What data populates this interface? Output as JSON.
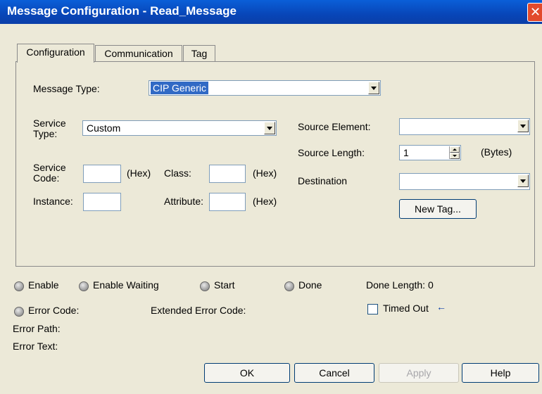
{
  "window": {
    "title": "Message Configuration - Read_Message",
    "close_glyph": "✕"
  },
  "tabs": [
    {
      "label": "Configuration",
      "active": true
    },
    {
      "label": "Communication",
      "active": false
    },
    {
      "label": "Tag",
      "active": false
    }
  ],
  "config": {
    "message_type_label": "Message Type:",
    "message_type_value": "CIP Generic",
    "service_type_label_1": "Service",
    "service_type_label_2": "Type:",
    "service_type_value": "Custom",
    "service_code_label_1": "Service",
    "service_code_label_2": "Code:",
    "service_code_value": "",
    "hex_label": "(Hex)",
    "class_label": "Class:",
    "class_value": "",
    "instance_label": "Instance:",
    "instance_value": "",
    "attribute_label": "Attribute:",
    "attribute_value": "",
    "source_element_label": "Source Element:",
    "source_element_value": "",
    "source_length_label": "Source Length:",
    "source_length_value": "1",
    "bytes_label": "(Bytes)",
    "destination_label": "Destination",
    "destination_value": "",
    "new_tag_label": "New Tag..."
  },
  "status": {
    "enable": "Enable",
    "enable_waiting": "Enable Waiting",
    "start": "Start",
    "done": "Done",
    "done_length": "Done Length: 0",
    "error_code": "Error Code:",
    "extended_error_code": "Extended Error Code:",
    "timed_out": "Timed Out",
    "timed_out_checked": false,
    "error_path": "Error Path:",
    "error_text": "Error Text:"
  },
  "buttons": {
    "ok": "OK",
    "cancel": "Cancel",
    "apply": "Apply",
    "help": "Help"
  },
  "colors": {
    "titlebar": "#0846b8",
    "dialog_bg": "#ece9d8",
    "selection": "#316ac5",
    "close": "#e24a2c"
  },
  "icons": {
    "led": "status-led-icon",
    "arrow": "left-arrow-icon",
    "dropdown": "chevron-down-icon"
  }
}
